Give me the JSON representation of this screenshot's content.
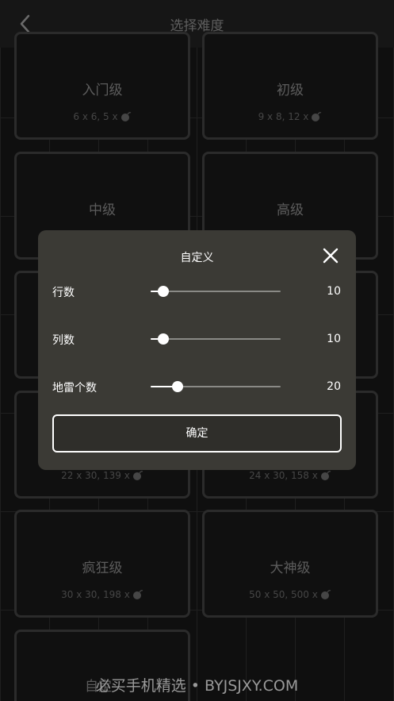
{
  "header": {
    "title": "选择难度",
    "back_icon": "chevron-left-icon"
  },
  "levels": [
    {
      "name": "入门级",
      "detail": "6 x 6,  5 x"
    },
    {
      "name": "初级",
      "detail": "9 x 8,  12 x"
    },
    {
      "name": "中级",
      "detail": ""
    },
    {
      "name": "高级",
      "detail": ""
    },
    {
      "name": "",
      "detail": ""
    },
    {
      "name": "",
      "detail": ""
    },
    {
      "name": "",
      "detail": "22 x 30,  139 x"
    },
    {
      "name": "",
      "detail": "24 x 30,  158 x"
    },
    {
      "name": "疯狂级",
      "detail": "30 x 30,  198 x"
    },
    {
      "name": "大神级",
      "detail": "50 x 50,  500 x"
    },
    {
      "name": "自定",
      "detail": ""
    }
  ],
  "dialog": {
    "title": "自定义",
    "close_icon": "close-icon",
    "rows": [
      {
        "label": "行数",
        "value": "10",
        "fraction": 0.1
      },
      {
        "label": "列数",
        "value": "10",
        "fraction": 0.1
      },
      {
        "label": "地雷个数",
        "value": "20",
        "fraction": 0.21
      }
    ],
    "confirm_label": "确定"
  },
  "watermark": "必买手机精选 • BYJSJXY.COM"
}
